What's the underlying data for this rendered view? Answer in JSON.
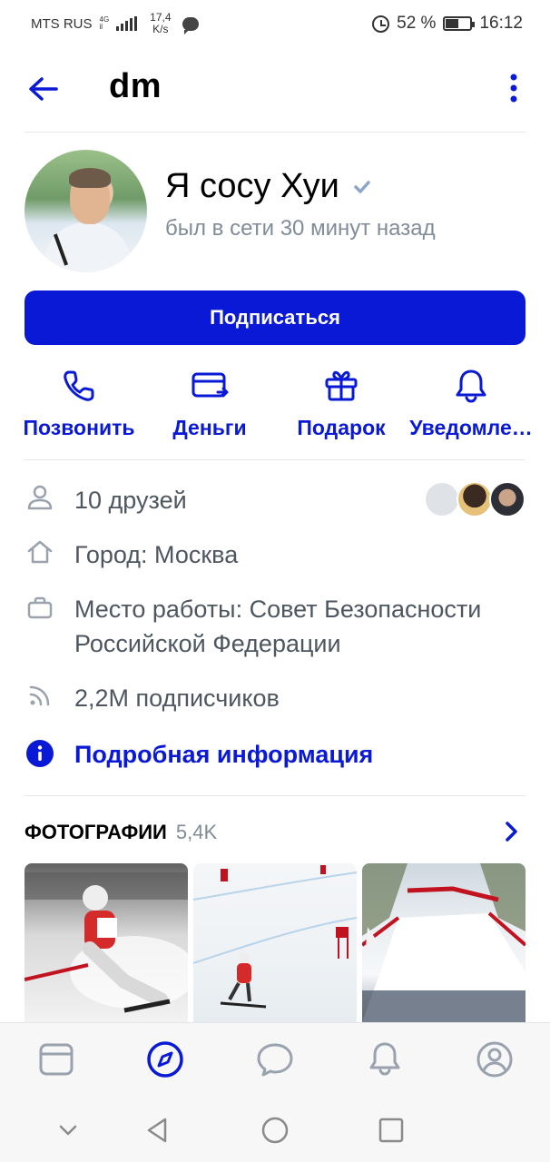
{
  "status_bar": {
    "carrier": "MTS RUS",
    "network_top": "4G",
    "network_bottom": "il",
    "speed_value": "17,4",
    "speed_unit": "K/s",
    "battery": "52 %",
    "battery_level": 0.52,
    "time": "16:12"
  },
  "header": {
    "title": "dm"
  },
  "profile": {
    "name": "Я сосу Хуи",
    "status": "был в сети 30 минут назад",
    "subscribe_label": "Подписаться"
  },
  "actions": [
    {
      "label": "Позвонить",
      "icon": "phone-icon"
    },
    {
      "label": "Деньги",
      "icon": "card-icon"
    },
    {
      "label": "Подарок",
      "icon": "gift-icon"
    },
    {
      "label": "Уведомле…",
      "icon": "bell-icon"
    }
  ],
  "info": {
    "friends": "10 друзей",
    "city": "Город: Москва",
    "work": "Место работы: Совет Безопасности Российской Федерации",
    "followers": "2,2M подписчиков",
    "details_link": "Подробная информация"
  },
  "photos": {
    "title": "ФОТОГРАФИИ",
    "count": "5,4K"
  },
  "colors": {
    "accent": "#0a19d6",
    "secondary_text": "#818c99",
    "info_text": "#4e5660"
  }
}
